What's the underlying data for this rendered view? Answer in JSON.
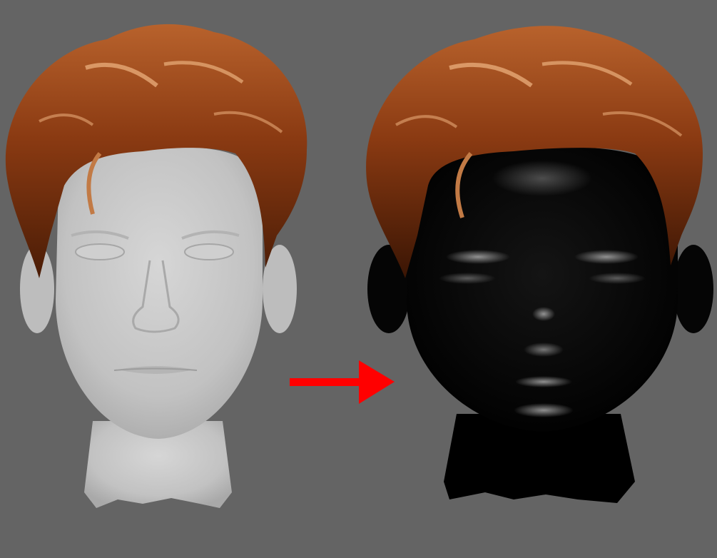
{
  "viewport": {
    "background_color": "#646464"
  },
  "renders": {
    "left_head": {
      "skin_material": "grey-clay",
      "skin_color": "#c6c6c6",
      "hair_color": "#8a3a12",
      "hair_highlight_color": "#e0a070"
    },
    "right_head": {
      "skin_material": "black-glossy",
      "skin_color": "#050505",
      "hair_color": "#8a3a12",
      "hair_highlight_color": "#e0a070"
    }
  },
  "arrow": {
    "icon": "arrow-right-icon",
    "color": "#ff0000"
  }
}
